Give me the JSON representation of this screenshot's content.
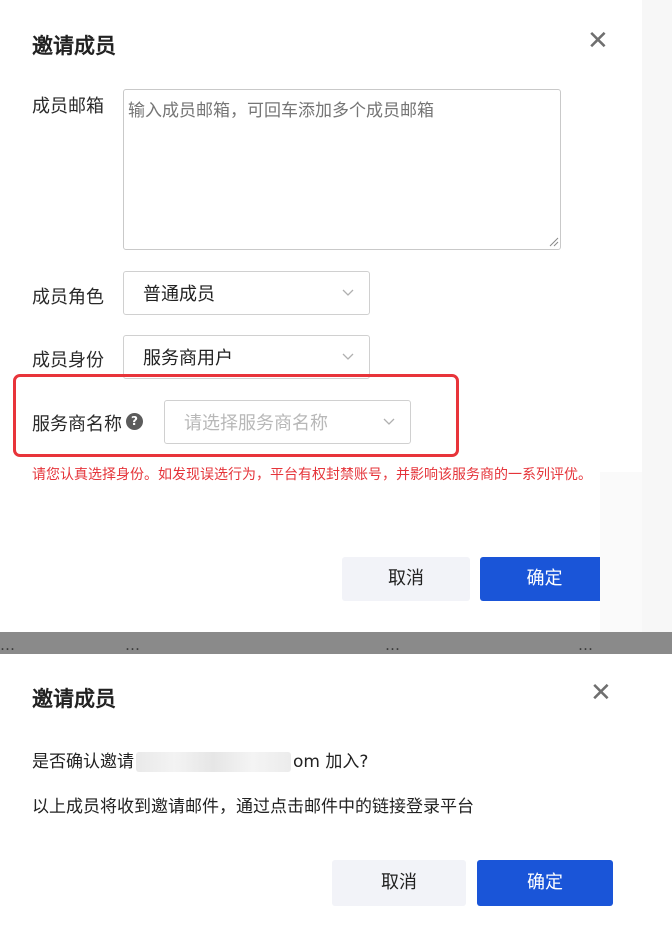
{
  "invite_dialog": {
    "title": "邀请成员",
    "close_icon": "close-icon",
    "email": {
      "label": "成员邮箱",
      "placeholder": "输入成员邮箱，可回车添加多个成员邮箱",
      "value": ""
    },
    "role": {
      "label": "成员角色",
      "selected": "普通成员"
    },
    "identity": {
      "label": "成员身份",
      "selected": "服务商用户"
    },
    "provider": {
      "label": "服务商名称",
      "help_icon": "question-circle-icon",
      "placeholder": "请选择服务商名称"
    },
    "warning": "请您认真选择身份。如发现误选行为，平台有权封禁账号，并影响该服务商的一系列评优。",
    "cancel_label": "取消",
    "ok_label": "确定",
    "highlight_color": "#e8343a",
    "warning_color": "#e5343a"
  },
  "background": {
    "fragments": [
      "…",
      "…",
      "…",
      "…"
    ]
  },
  "confirm_dialog": {
    "title": "邀请成员",
    "close_icon": "close-icon",
    "question_prefix": "是否确认邀请",
    "question_suffix": "om 加入?",
    "info": "以上成员将收到邀请邮件，通过点击邮件中的链接登录平台",
    "cancel_label": "取消",
    "ok_label": "确定"
  },
  "colors": {
    "primary": "#1a55d8",
    "cancel_bg": "#f2f3f8"
  }
}
